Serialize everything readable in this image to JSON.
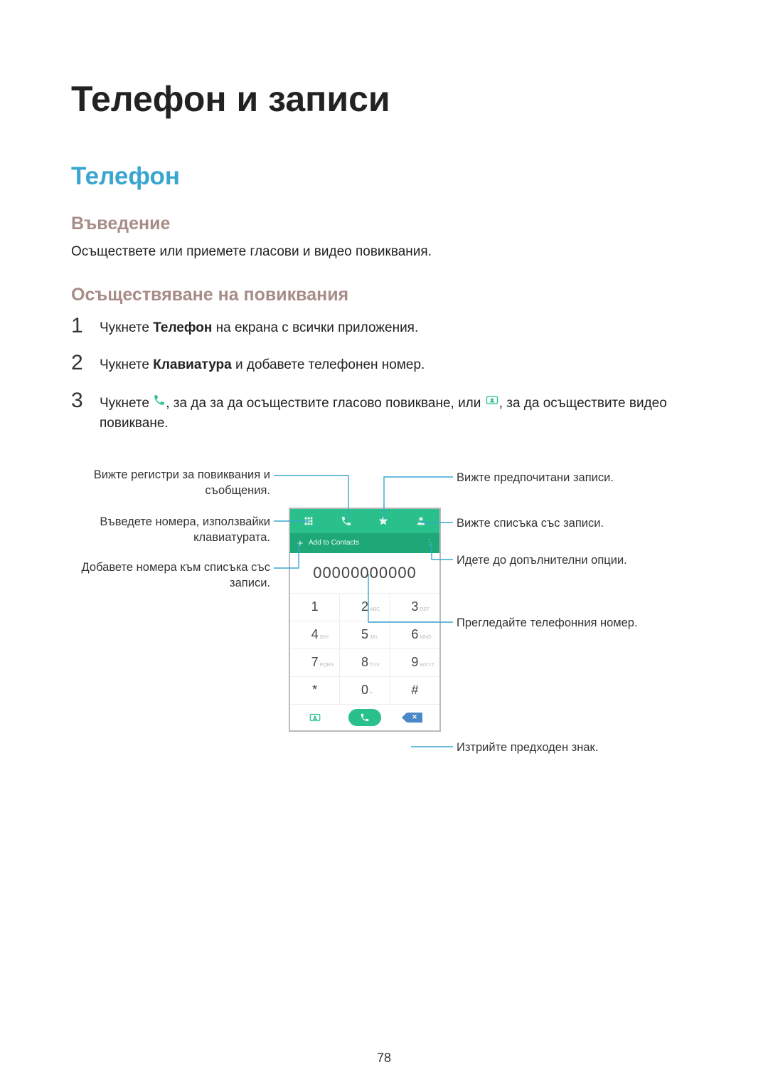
{
  "headings": {
    "h1": "Телефон и записи",
    "h2": "Телефон",
    "h3_intro": "Въведение",
    "h3_calls": "Осъществяване на повиквания"
  },
  "intro_text": "Осъществете или приемете гласови и видео повиквания.",
  "steps": {
    "s1_pre": "Чукнете ",
    "s1_bold": "Телефон",
    "s1_post": " на екрана с всички приложения.",
    "s2_pre": "Чукнете ",
    "s2_bold": "Клавиатура",
    "s2_post": " и добавете телефонен номер.",
    "s3_pre": "Чукнете ",
    "s3_mid": ", за да за да осъществите гласово повикване, или ",
    "s3_post": ", за да осъществите видео повикване."
  },
  "callouts": {
    "left1": "Вижте регистри за повиквания и съобщения.",
    "left2": "Въведете номера, използвайки клавиатурата.",
    "left3": "Добавете номера към списъка със записи.",
    "right1": "Вижте предпочитани записи.",
    "right2": "Вижте списъка със записи.",
    "right3": "Идете до допълнителни опции.",
    "right4": "Прегледайте телефонния номер.",
    "right5": "Изтрийте предходен знак."
  },
  "dialer": {
    "number": "00000000000",
    "add_label": "Add to Contacts",
    "keys": [
      [
        "1",
        ""
      ],
      [
        "2",
        "ABC"
      ],
      [
        "3",
        "DEF"
      ],
      [
        "4",
        "GHI"
      ],
      [
        "5",
        "JKL"
      ],
      [
        "6",
        "MNO"
      ],
      [
        "7",
        "PQRS"
      ],
      [
        "8",
        "TUV"
      ],
      [
        "9",
        "WXYZ"
      ],
      [
        "*",
        ""
      ],
      [
        "0",
        "+"
      ],
      [
        "#",
        ""
      ]
    ]
  },
  "page_number": "78",
  "colors": {
    "accent": "#3aa6d0",
    "green": "#29c08b",
    "leader": "#3aa6d0"
  }
}
